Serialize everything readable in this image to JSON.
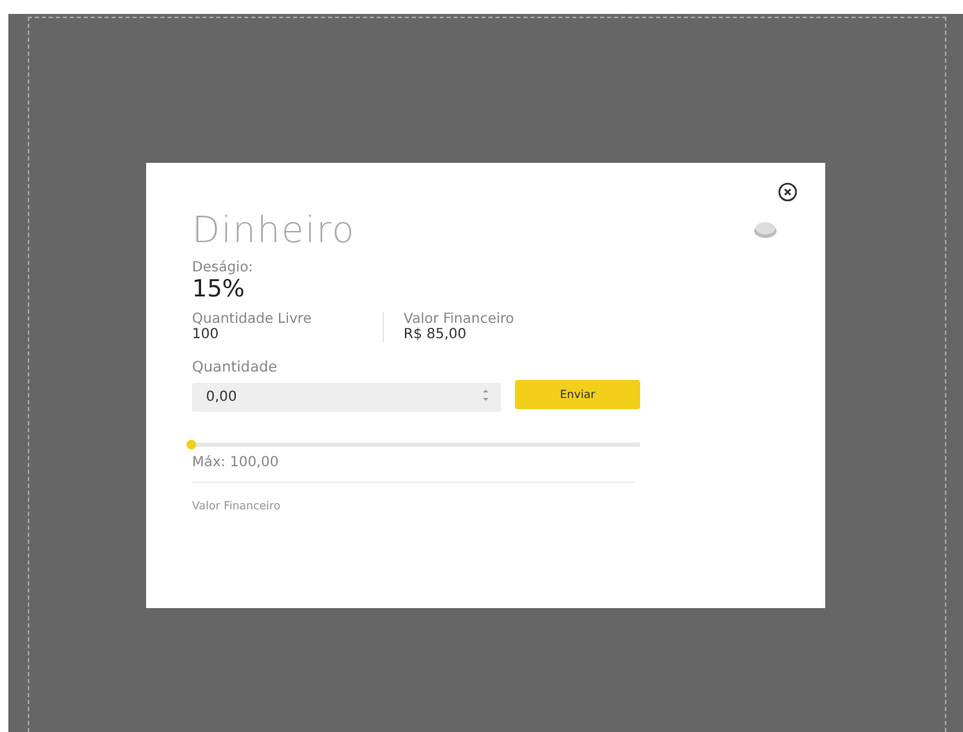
{
  "modal": {
    "title": "Dinheiro",
    "discount_label": "Deságio:",
    "discount_value": "15%",
    "stats": [
      {
        "label": "Quantidade Livre",
        "value": "100"
      },
      {
        "label": "Valor Financeiro",
        "value": "R$ 85,00"
      }
    ],
    "quantity": {
      "label": "Quantidade",
      "value": "0,00"
    },
    "submit_button": "Enviar",
    "slider": {
      "level": 0
    },
    "max_label": "Máx: 100,00",
    "footer_label": "Valor Financeiro"
  }
}
